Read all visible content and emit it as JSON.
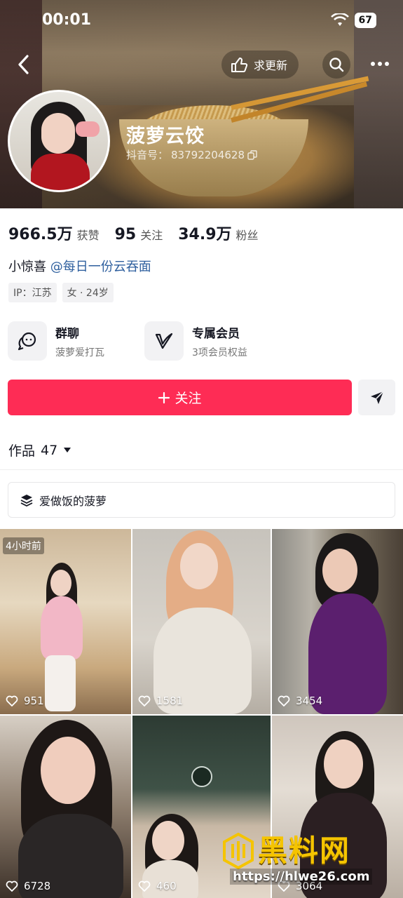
{
  "status_bar": {
    "time": "00:01",
    "battery": "67"
  },
  "header": {
    "update_label": "求更新"
  },
  "profile": {
    "nickname": "菠萝云饺",
    "douyin_id_label": "抖音号：",
    "douyin_id": "83792204628",
    "stats": [
      {
        "value": "966.5万",
        "label": "获赞"
      },
      {
        "value": "95",
        "label": "关注"
      },
      {
        "value": "34.9万",
        "label": "粉丝"
      }
    ],
    "bio_prefix": "小惊喜",
    "bio_mention": "@每日一份云吞面",
    "tags": [
      "IP：江苏",
      "女 · 24岁"
    ]
  },
  "features": [
    {
      "title": "群聊",
      "subtitle": "菠萝爱打瓦",
      "icon": "chat-bubble-icon"
    },
    {
      "title": "专属会员",
      "subtitle": "3项会员权益",
      "icon": "v-member-icon"
    }
  ],
  "actions": {
    "follow_label": "关注"
  },
  "works": {
    "label": "作品",
    "count": "47"
  },
  "collection": {
    "label": "爱做饭的菠萝"
  },
  "videos": [
    {
      "likes": "951",
      "badge": "4小时前"
    },
    {
      "likes": "1581"
    },
    {
      "likes": "3454"
    },
    {
      "likes": "6728"
    },
    {
      "likes": "460"
    },
    {
      "likes": "3064"
    }
  ],
  "watermark": {
    "text": "黑料网",
    "url": "https://hlwe26.com"
  },
  "colors": {
    "accent": "#fe2c55",
    "mention": "#2e5f9e",
    "watermark": "#f5c400"
  }
}
